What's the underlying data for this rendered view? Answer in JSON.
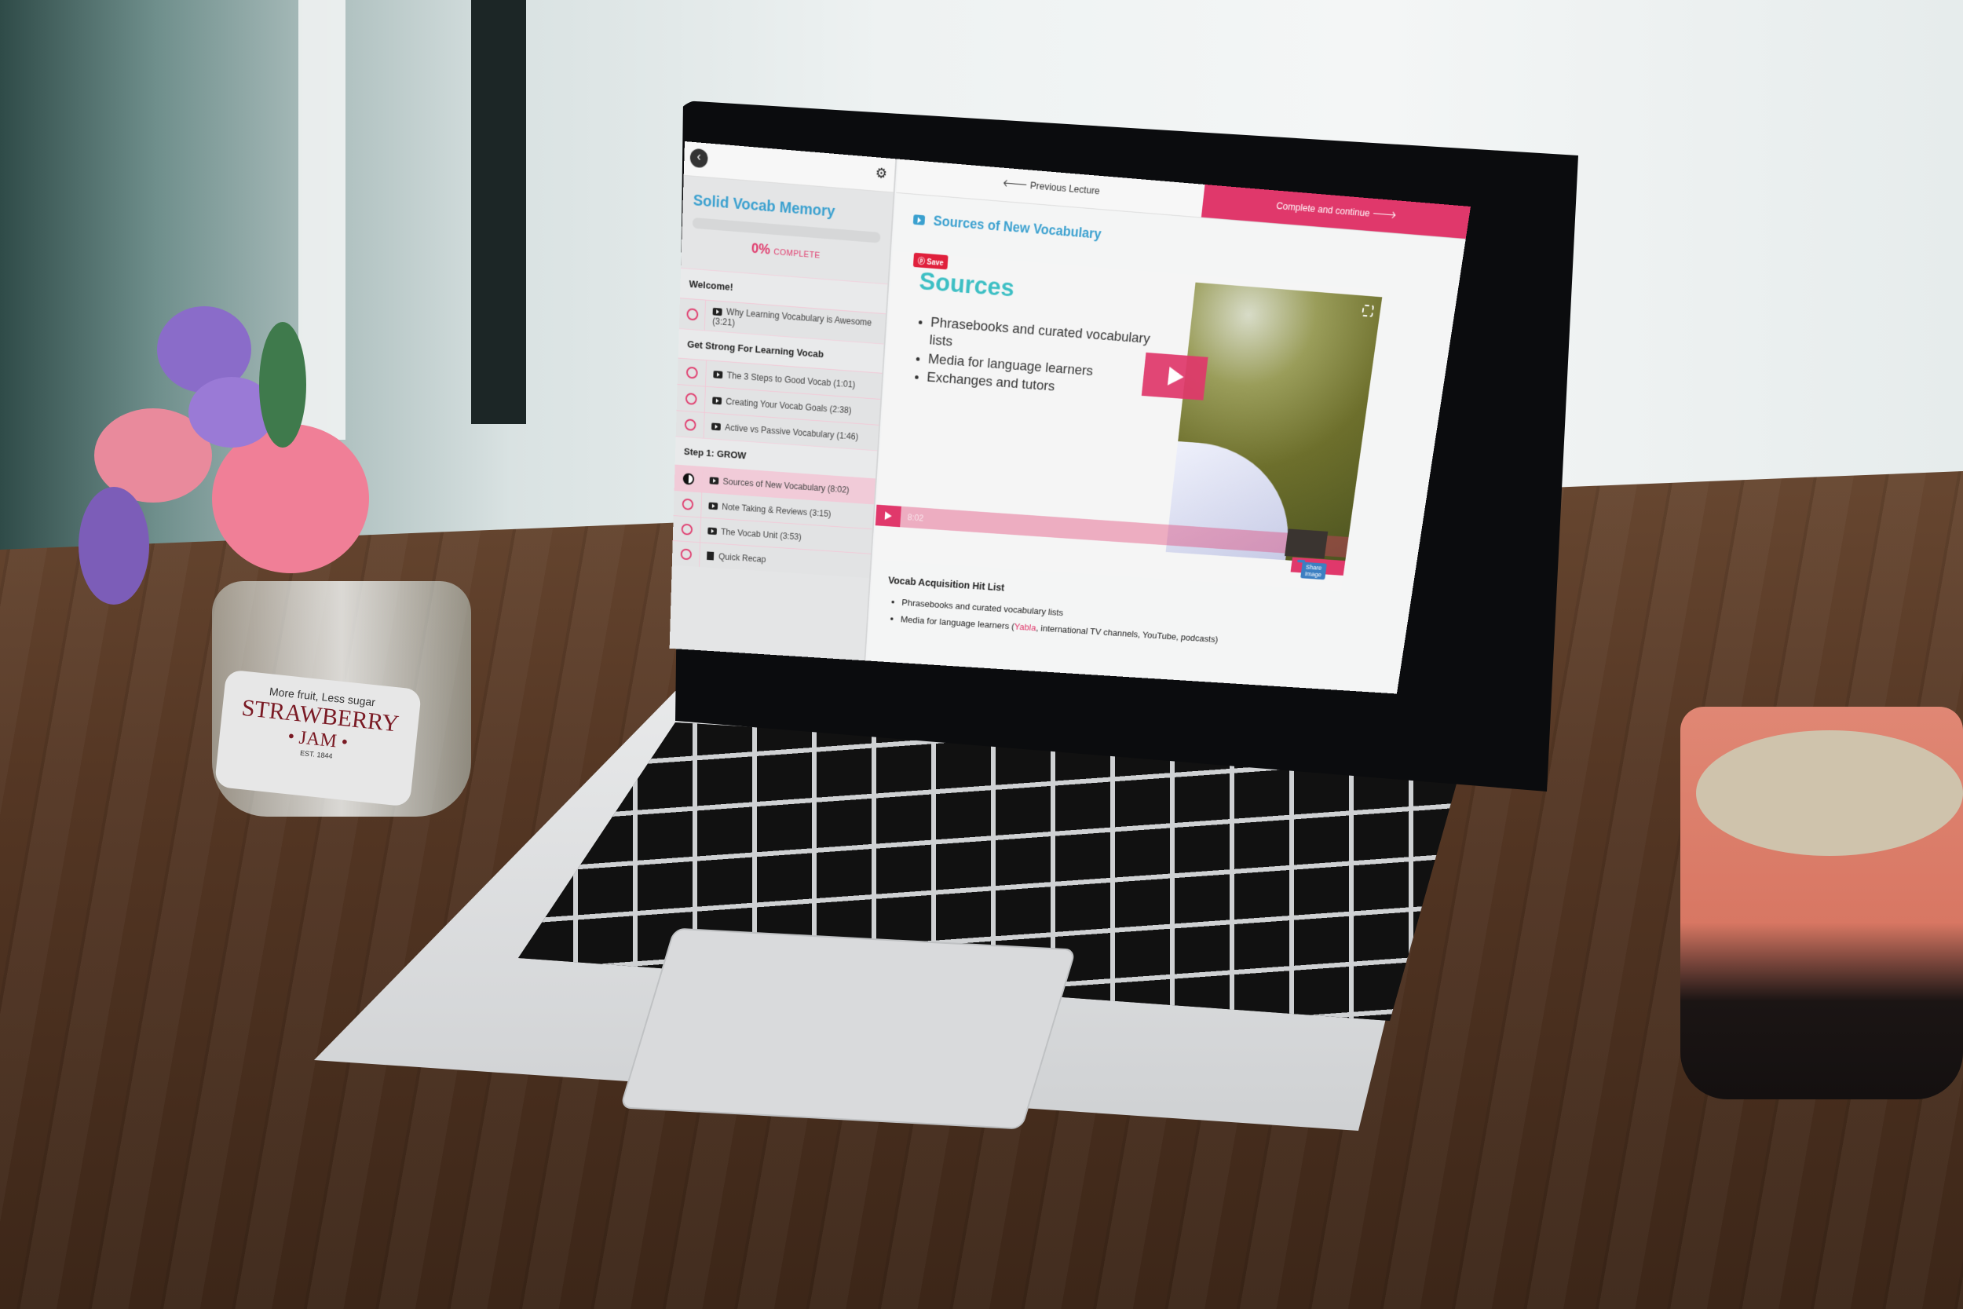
{
  "course": {
    "title": "Solid Vocab Memory",
    "progress_percent": 0,
    "progress_label": "0%",
    "progress_suffix": "COMPLETE"
  },
  "nav": {
    "previous_label": "Previous Lecture",
    "complete_label": "Complete and continue"
  },
  "sections": [
    {
      "title": "Welcome!",
      "lessons": [
        {
          "title": "Why Learning Vocabulary is Awesome (3:21)",
          "type": "video",
          "status": "incomplete"
        }
      ]
    },
    {
      "title": "Get Strong For Learning Vocab",
      "lessons": [
        {
          "title": "The 3 Steps to Good Vocab (1:01)",
          "type": "video",
          "status": "incomplete"
        },
        {
          "title": "Creating Your Vocab Goals (2:38)",
          "type": "video",
          "status": "incomplete"
        },
        {
          "title": "Active vs Passive Vocabulary (1:46)",
          "type": "video",
          "status": "incomplete"
        }
      ]
    },
    {
      "title": "Step 1: GROW",
      "lessons": [
        {
          "title": "Sources of New Vocabulary (8:02)",
          "type": "video",
          "status": "in-progress"
        },
        {
          "title": "Note Taking & Reviews (3:15)",
          "type": "video",
          "status": "incomplete"
        },
        {
          "title": "The Vocab Unit (3:53)",
          "type": "video",
          "status": "incomplete"
        },
        {
          "title": "Quick Recap",
          "type": "text",
          "status": "incomplete"
        }
      ]
    }
  ],
  "lecture": {
    "title": "Sources of New Vocabulary",
    "save_label": "Save",
    "slide_heading": "Sources",
    "slide_bullets": [
      "Phrasebooks and curated vocabulary lists",
      "Media for language learners",
      "Exchanges and tutors"
    ],
    "video_duration": "8:02",
    "share_label": "Share Image",
    "notes_heading": "Vocab Acquisition Hit List",
    "notes": [
      {
        "text": "Phrasebooks and curated vocabulary lists"
      },
      {
        "before": "Media for language learners (",
        "link": "Yabla",
        "after": ", international TV channels, YouTube, podcasts)"
      }
    ]
  },
  "colors": {
    "accent_pink": "#e0386b",
    "title_blue": "#3aa0cf",
    "slide_teal": "#3dbfc4"
  },
  "jar_label": {
    "tagline": "More fruit, Less sugar",
    "brand": "STRAWBERRY",
    "product": "• JAM •",
    "est": "EST. 1844"
  }
}
